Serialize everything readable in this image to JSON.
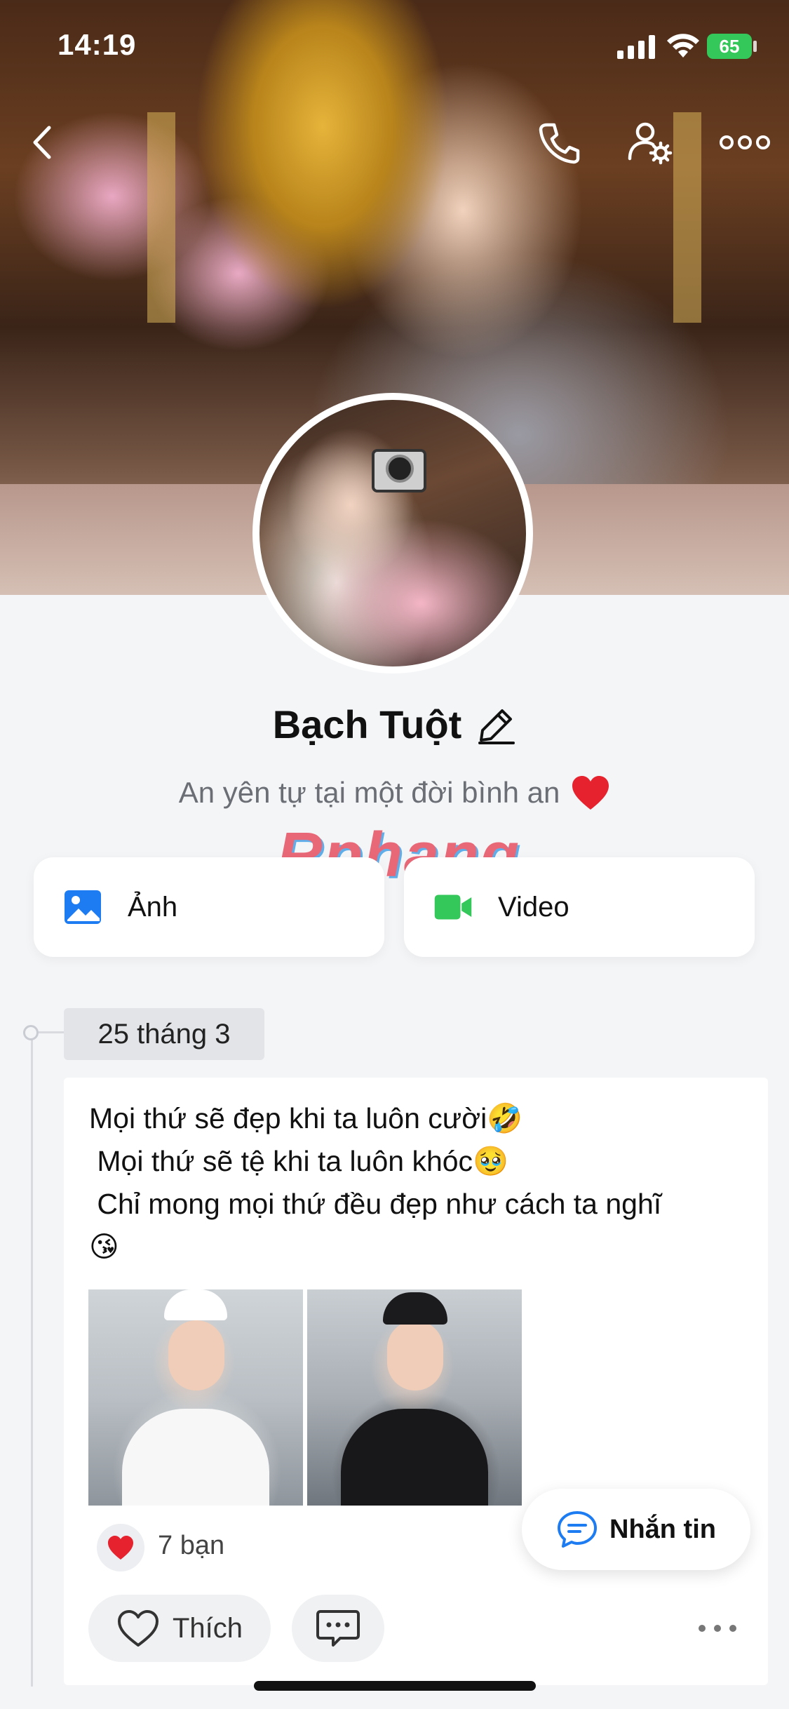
{
  "status_bar": {
    "time": "14:19",
    "battery": "65"
  },
  "colors": {
    "accent_blue": "#1e7cf2",
    "video_green": "#34c759",
    "heart_red": "#e5222d",
    "watermark_red": "#e8596b",
    "watermark_blue": "#4fa7e8"
  },
  "header_icons": [
    "back-icon",
    "phone-icon",
    "user-settings-icon",
    "more-icon"
  ],
  "profile": {
    "name": "Bạch Tuột",
    "bio": "An yên tự tại một đời bình an"
  },
  "watermark": "Rphang",
  "media": {
    "photos_label": "Ảnh",
    "videos_label": "Video"
  },
  "timeline": {
    "date": "25 tháng 3"
  },
  "post": {
    "lines": [
      "Mọi thứ sẽ đẹp khi ta luôn cười🤣",
      " Mọi thứ sẽ tệ khi ta luôn khóc🥹",
      " Chỉ mong mọi thứ đều đẹp như cách ta nghĩ",
      "😘"
    ],
    "reaction_count": "7 bạn",
    "like_label": "Thích"
  },
  "floating": {
    "message_label": "Nhắn tin"
  }
}
